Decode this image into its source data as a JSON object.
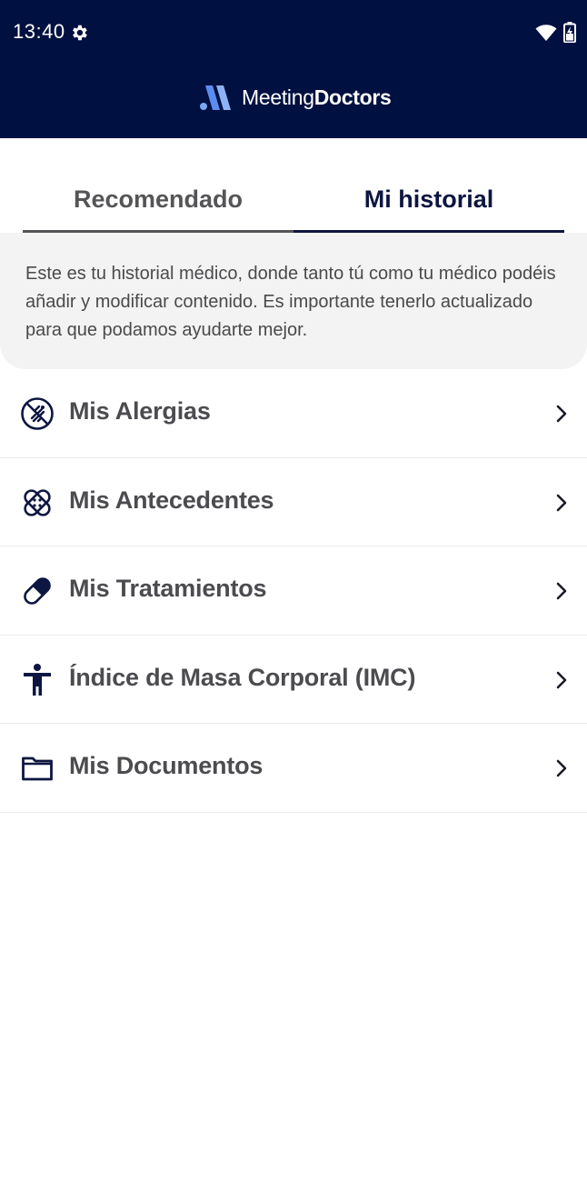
{
  "status_bar": {
    "time": "13:40",
    "icons": [
      "gear-icon",
      "wifi-icon",
      "battery-charging-icon"
    ]
  },
  "brand": {
    "name_light": "Meeting",
    "name_bold": "Doctors",
    "logo_color": "#5b8def"
  },
  "colors": {
    "header_bg": "#001040",
    "active_tab": "#0d1640",
    "inactive_tab": "#555558",
    "info_bg": "#f3f3f3"
  },
  "tabs": [
    {
      "label": "Recomendado",
      "active": false
    },
    {
      "label": "Mi historial",
      "active": true
    }
  ],
  "info": {
    "text": "Este es tu historial médico, donde tanto tú como tu médico podéis añadir y modificar contenido. Es importante tenerlo actualizado para que podamos ayudarte mejor."
  },
  "menu": [
    {
      "label": "Mis Alergias",
      "icon": "no-allergy-icon"
    },
    {
      "label": "Mis Antecedentes",
      "icon": "bandage-icon"
    },
    {
      "label": "Mis Tratamientos",
      "icon": "pill-icon"
    },
    {
      "label": "Índice de Masa Corporal (IMC)",
      "icon": "person-icon"
    },
    {
      "label": "Mis Documentos",
      "icon": "folder-icon"
    }
  ]
}
